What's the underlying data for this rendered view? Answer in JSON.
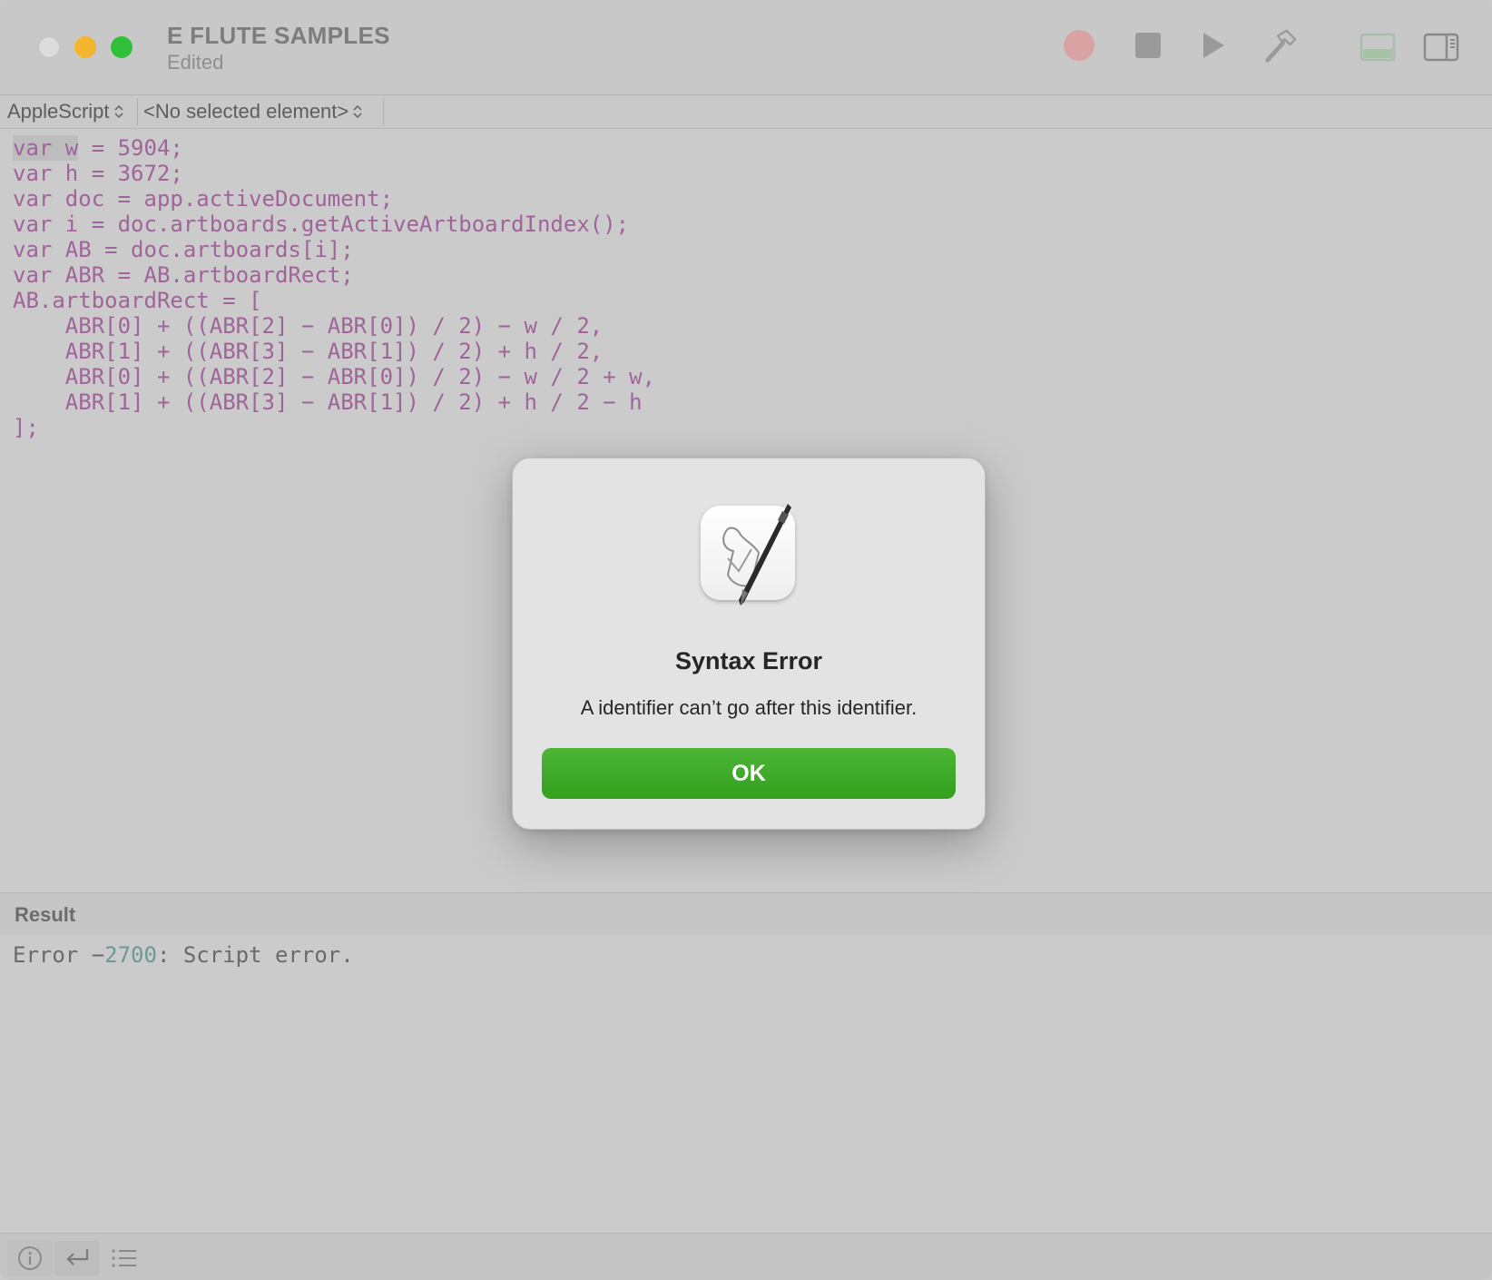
{
  "window": {
    "title": "E FLUTE SAMPLES",
    "subtitle": "Edited"
  },
  "toolbar": {
    "buttons": [
      {
        "name": "record",
        "icon": "record-icon"
      },
      {
        "name": "stop",
        "icon": "stop-icon"
      },
      {
        "name": "run",
        "icon": "play-icon"
      },
      {
        "name": "compile",
        "icon": "hammer-icon"
      },
      {
        "name": "show-log",
        "icon": "bottom-panel-icon"
      },
      {
        "name": "show-sidebar",
        "icon": "right-sidebar-icon"
      }
    ]
  },
  "navbar": {
    "language": "AppleScript",
    "element": "<No selected element>"
  },
  "editor": {
    "lines": [
      "var w = 5904;",
      "var h = 3672;",
      "var doc = app.activeDocument;",
      "var i = doc.artboards.getActiveArtboardIndex();",
      "var AB = doc.artboards[i];",
      "var ABR = AB.artboardRect;",
      "AB.artboardRect = [",
      "    ABR[0] + ((ABR[2] − ABR[0]) / 2) − w / 2,",
      "    ABR[1] + ((ABR[3] − ABR[1]) / 2) + h / 2,",
      "    ABR[0] + ((ABR[2] − ABR[0]) / 2) − w / 2 + w,",
      "    ABR[1] + ((ABR[3] − ABR[1]) / 2) + h / 2 − h",
      "];"
    ],
    "highlighted": "var w"
  },
  "result": {
    "label": "Result",
    "prefix": "Error −",
    "code": "2700",
    "suffix": ": Script error."
  },
  "bottombar": {
    "buttons": [
      {
        "name": "info",
        "icon": "info-icon"
      },
      {
        "name": "replies",
        "icon": "return-arrow-icon"
      },
      {
        "name": "events",
        "icon": "list-icon"
      }
    ]
  },
  "dialog": {
    "title": "Syntax Error",
    "message": "A identifier can’t go after this identifier.",
    "ok_label": "OK",
    "icon": "script-editor-app-icon"
  },
  "colors": {
    "code_text": "#a0649a",
    "ok_button": "#3aa826",
    "error_number": "#6b9898"
  }
}
